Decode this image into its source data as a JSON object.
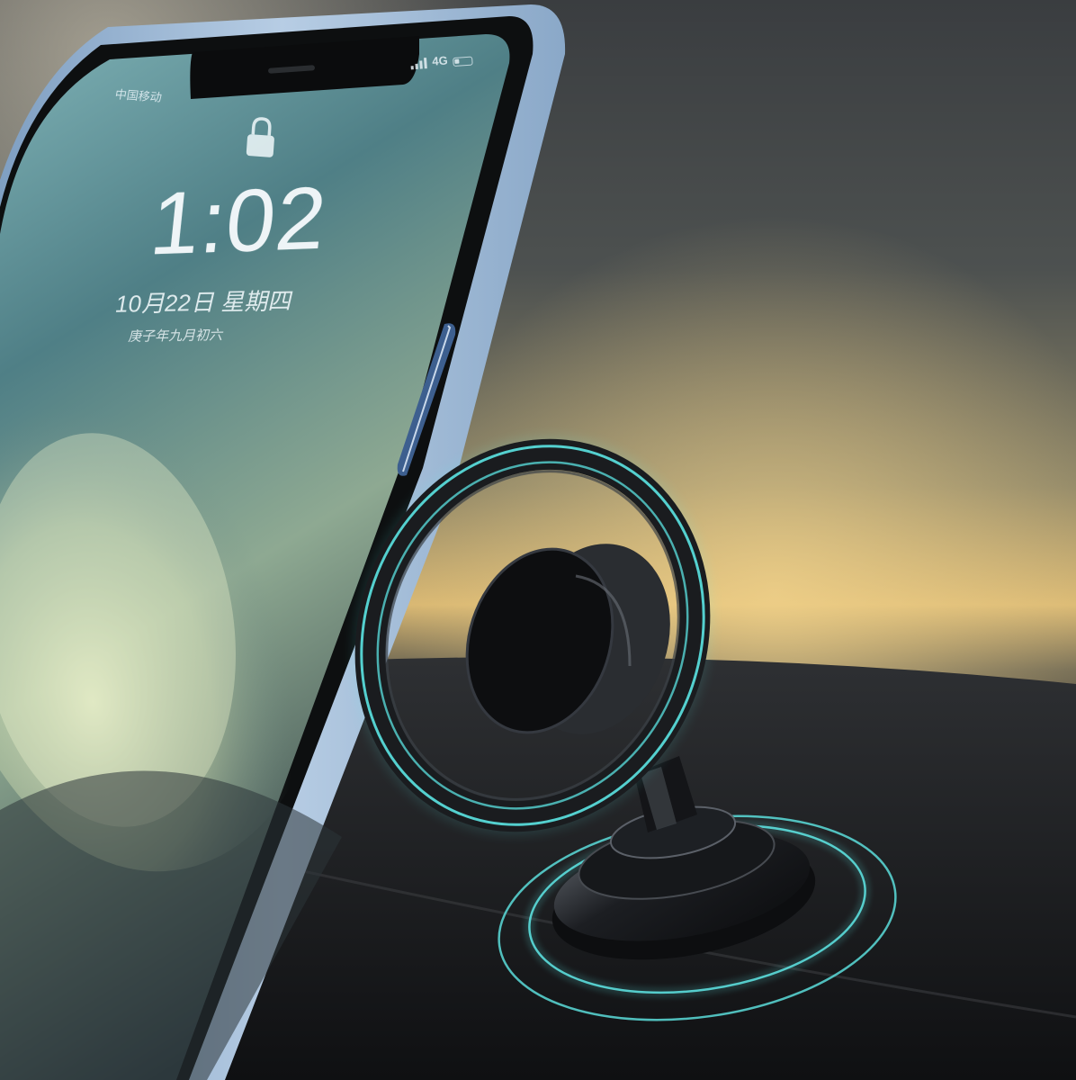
{
  "lock_screen": {
    "carrier": "中国移动",
    "network": "4G",
    "time": "1:02",
    "date": "10月22日 星期四",
    "lunar_date": "庚子年九月初六"
  },
  "icons": [
    "lock-icon",
    "signal-icon",
    "battery-icon"
  ],
  "colors": {
    "phone_frame": "#9ab8d8",
    "screen_teal": "#3f6b78",
    "glow_cyan": "#5ff0ee",
    "mount_black": "#141518",
    "background_amber": "#e0c48a"
  }
}
